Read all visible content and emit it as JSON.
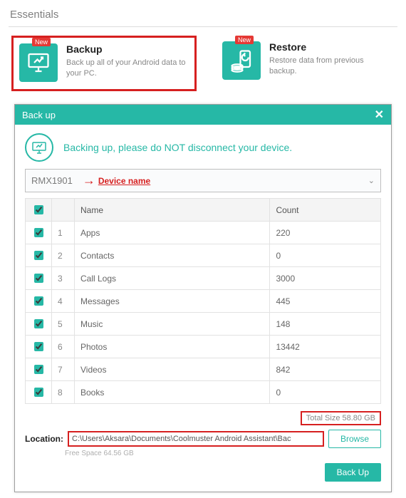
{
  "section_title": "Essentials",
  "tiles": {
    "backup": {
      "badge": "New",
      "title": "Backup",
      "desc": "Back up all of your Android data to your PC."
    },
    "restore": {
      "badge": "New",
      "title": "Restore",
      "desc": "Restore data from previous backup."
    }
  },
  "modal": {
    "title": "Back up",
    "instruction": "Backing up, please do NOT disconnect your device.",
    "device_name": "RMX1901",
    "device_name_annotation": "Device name",
    "table": {
      "headers": {
        "name": "Name",
        "count": "Count"
      },
      "rows": [
        {
          "idx": "1",
          "name": "Apps",
          "count": "220",
          "checked": true
        },
        {
          "idx": "2",
          "name": "Contacts",
          "count": "0",
          "checked": true
        },
        {
          "idx": "3",
          "name": "Call Logs",
          "count": "3000",
          "checked": true
        },
        {
          "idx": "4",
          "name": "Messages",
          "count": "445",
          "checked": true
        },
        {
          "idx": "5",
          "name": "Music",
          "count": "148",
          "checked": true
        },
        {
          "idx": "6",
          "name": "Photos",
          "count": "13442",
          "checked": true
        },
        {
          "idx": "7",
          "name": "Videos",
          "count": "842",
          "checked": true
        },
        {
          "idx": "8",
          "name": "Books",
          "count": "0",
          "checked": true
        }
      ]
    },
    "total_size_label": "Total Size 58.80 GB",
    "location_label": "Location:",
    "location_path": "C:\\Users\\Aksara\\Documents\\Coolmuster Android Assistant\\Bac",
    "free_space": "Free Space 64.56 GB",
    "browse_button": "Browse",
    "backup_button": "Back Up"
  }
}
